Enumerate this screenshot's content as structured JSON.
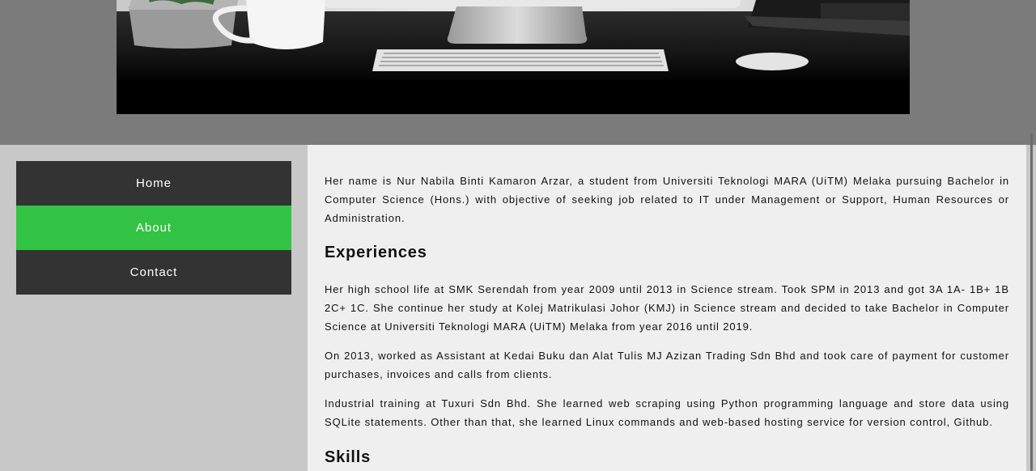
{
  "nav": {
    "items": [
      {
        "label": "Home",
        "active": false
      },
      {
        "label": "About",
        "active": true
      },
      {
        "label": "Contact",
        "active": false
      }
    ]
  },
  "about": {
    "intro": "Her name is Nur Nabila Binti Kamaron Arzar, a student from Universiti Teknologi MARA (UiTM) Melaka pursuing Bachelor in Computer Science (Hons.) with objective of seeking job related to IT under Management or Support, Human Resources or Administration.",
    "experiences_heading": "Experiences",
    "experiences": [
      "Her high school life at SMK Serendah from year 2009 until 2013 in Science stream. Took SPM in 2013 and got 3A 1A- 1B+ 1B 2C+ 1C. She continue her study at Kolej Matrikulasi Johor (KMJ) in Science stream and decided to take Bachelor in Computer Science at Universiti Teknologi MARA (UiTM) Melaka from year 2016 until 2019.",
      "On 2013, worked as Assistant at Kedai Buku dan Alat Tulis MJ Azizan Trading Sdn Bhd and took care of payment for customer purchases, invoices and calls from clients.",
      "Industrial training at Tuxuri Sdn Bhd. She learned web scraping using Python programming language and store data using SQLite statements. Other than that, she learned Linux commands and web-based hosting service for version control, Github."
    ],
    "skills_heading": "Skills"
  },
  "colors": {
    "header_bg": "#7b7b7b",
    "sidebar_bg": "#c8c8c8",
    "nav_bg": "#333333",
    "nav_active": "#33c344",
    "main_bg": "#efefef"
  }
}
